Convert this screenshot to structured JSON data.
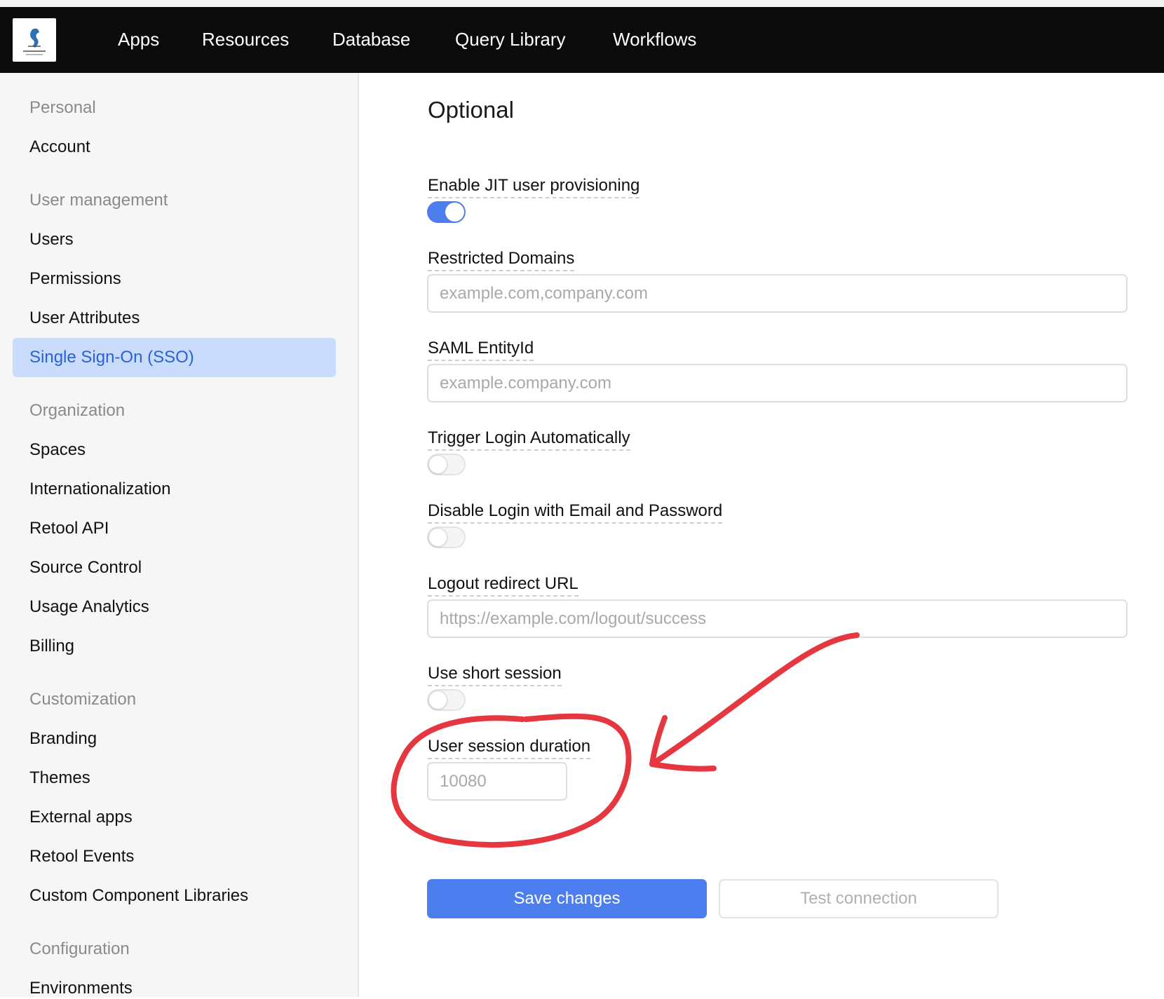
{
  "nav": {
    "items": [
      "Apps",
      "Resources",
      "Database",
      "Query Library",
      "Workflows"
    ]
  },
  "sidebar": {
    "personal": {
      "heading": "Personal",
      "items": [
        "Account"
      ]
    },
    "user_management": {
      "heading": "User management",
      "items": [
        "Users",
        "Permissions",
        "User Attributes",
        "Single Sign-On (SSO)"
      ]
    },
    "organization": {
      "heading": "Organization",
      "items": [
        "Spaces",
        "Internationalization",
        "Retool API",
        "Source Control",
        "Usage Analytics",
        "Billing"
      ]
    },
    "customization": {
      "heading": "Customization",
      "items": [
        "Branding",
        "Themes",
        "External apps",
        "Retool Events",
        "Custom Component Libraries"
      ]
    },
    "configuration": {
      "heading": "Configuration",
      "items": [
        "Environments"
      ]
    },
    "active_item": "Single Sign-On (SSO)"
  },
  "main": {
    "title": "Optional",
    "jit": {
      "label": "Enable JIT user provisioning",
      "enabled": true
    },
    "restricted_domains": {
      "label": "Restricted Domains",
      "placeholder": "example.com,company.com"
    },
    "saml_entity_id": {
      "label": "SAML EntityId",
      "placeholder": "example.company.com"
    },
    "trigger_login": {
      "label": "Trigger Login Automatically",
      "enabled": false
    },
    "disable_login": {
      "label": "Disable Login with Email and Password",
      "enabled": false
    },
    "logout_redirect": {
      "label": "Logout redirect URL",
      "placeholder": "https://example.com/logout/success"
    },
    "short_session": {
      "label": "Use short session",
      "enabled": false
    },
    "session_duration": {
      "label": "User session duration",
      "placeholder": "10080"
    },
    "save_label": "Save changes",
    "test_label": "Test connection"
  },
  "colors": {
    "accent": "#4d7ef0",
    "active_bg": "#c9dcfb",
    "active_text": "#2b61d8",
    "annotation": "#e5373f",
    "nav_bg": "#0b0b0b"
  }
}
